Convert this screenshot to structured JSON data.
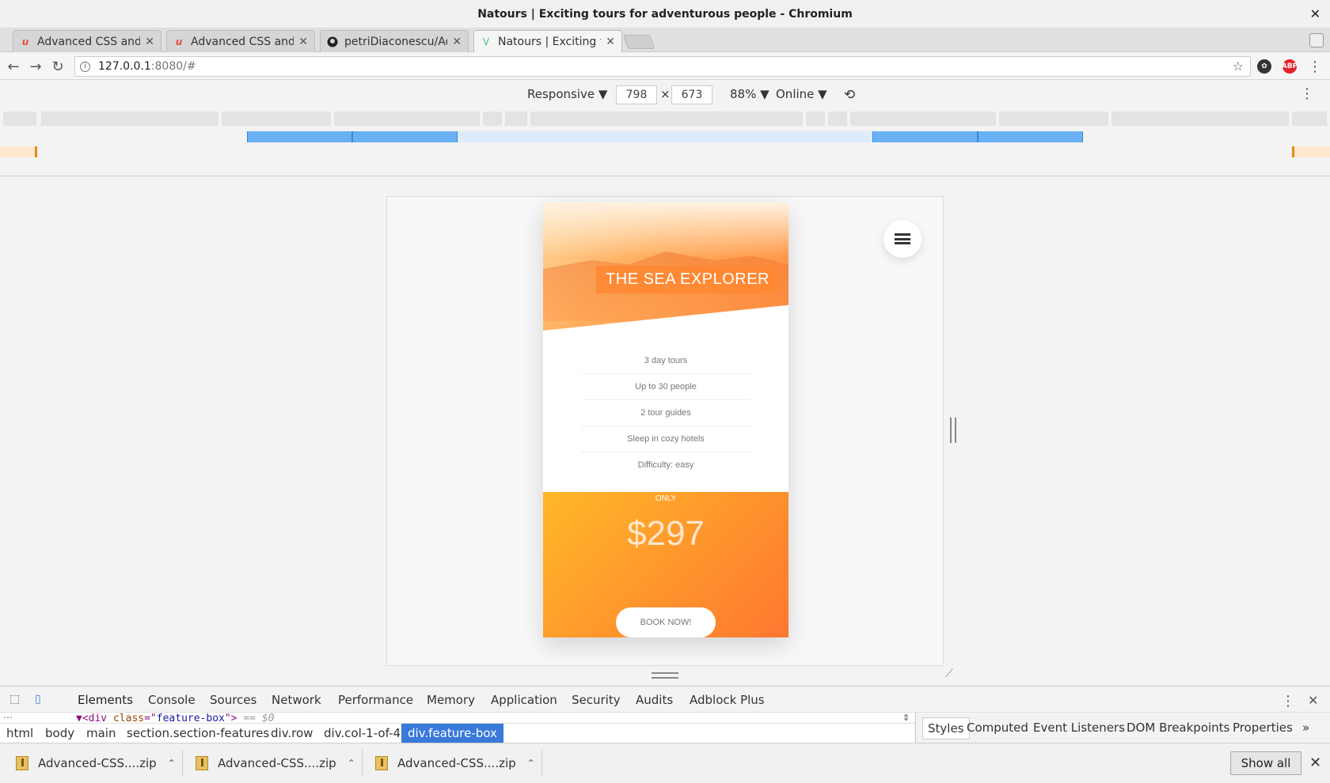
{
  "window": {
    "title": "Natours | Exciting tours for adventurous people - Chromium"
  },
  "tabs": [
    {
      "label": "Advanced CSS and S",
      "icon": "udemy-icon",
      "active": false
    },
    {
      "label": "Advanced CSS and S",
      "icon": "udemy-icon",
      "active": false
    },
    {
      "label": "petriDiaconescu/Adv",
      "icon": "github-icon",
      "active": false
    },
    {
      "label": "Natours | Exciting to",
      "icon": "natours-icon",
      "active": true
    }
  ],
  "address": {
    "host": "127.0.0.1",
    "path": ":8080/#"
  },
  "device_toolbar": {
    "device": "Responsive ▼",
    "width": "798",
    "times": "×",
    "height": "673",
    "zoom": "88% ▼",
    "network": "Online ▼"
  },
  "card": {
    "heading": "THE SEA EXPLORER",
    "details": [
      "3 day tours",
      "Up to 30 people",
      "2 tour guides",
      "Sleep in cozy hotels",
      "Difficulty: easy"
    ],
    "price_label": "ONLY",
    "price": "$297",
    "button": "BOOK NOW!"
  },
  "devtools": {
    "tabs": [
      "Elements",
      "Console",
      "Sources",
      "Network",
      "Performance",
      "Memory",
      "Application",
      "Security",
      "Audits",
      "Adblock Plus"
    ],
    "code": {
      "tag_open": "▼<div ",
      "attr": "class",
      "eq": "=\"",
      "value": "feature-box",
      "close": "\">",
      "marker": " == $0"
    },
    "breadcrumbs": [
      "html",
      "body",
      "main",
      "section.section-features",
      "div.row",
      "div.col-1-of-4",
      "div.feature-box"
    ],
    "side_tabs": [
      "Styles",
      "Computed",
      "Event Listeners",
      "DOM Breakpoints",
      "Properties"
    ],
    "more": "»"
  },
  "downloads": {
    "items": [
      "Advanced-CSS....zip",
      "Advanced-CSS....zip",
      "Advanced-CSS....zip"
    ],
    "show_all": "Show all"
  }
}
